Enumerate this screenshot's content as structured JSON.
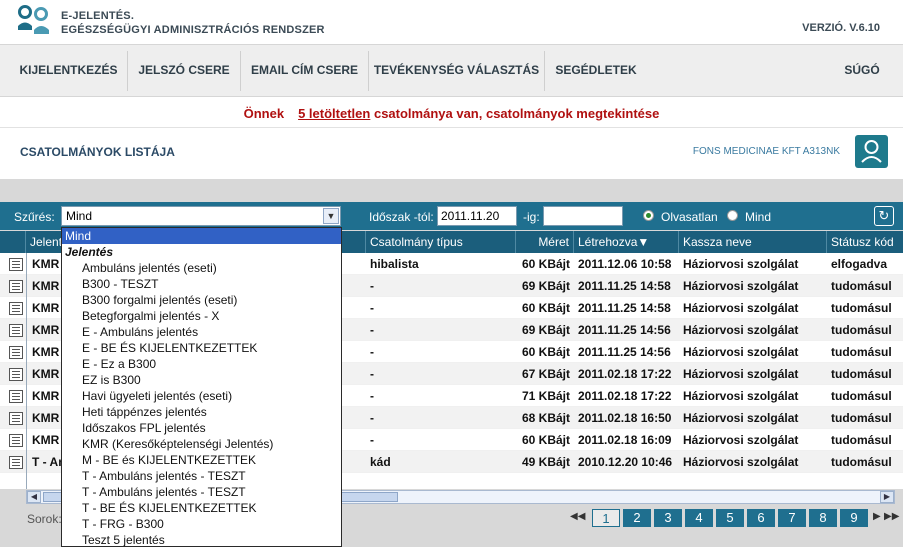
{
  "header": {
    "title_line1": "E-JELENTÉS.",
    "title_line2": "EGÉSZSÉGÜGYI ADMINISZTRÁCIÓS RENDSZER",
    "version": "VERZIÓ. V.6.10"
  },
  "nav": {
    "items": [
      "KIJELENTKEZÉS",
      "JELSZÓ CSERE",
      "EMAIL CÍM CSERE",
      "TEVÉKENYSÉG VÁLASZTÁS",
      "SEGÉDLETEK"
    ],
    "help": "SÚGÓ"
  },
  "notice": {
    "prefix": "Önnek",
    "link": "5 letöltetlen",
    "suffix": "csatolmánya van, csatolmányok megtekintése"
  },
  "page": {
    "title": "CSATOLMÁNYOK LISTÁJA",
    "company": "FONS MEDICINAE KFT A313NK"
  },
  "filter": {
    "label": "Szűrés:",
    "selected": "Mind",
    "period_from_label": "Időszak -tól:",
    "period_from_value": "2011.11.20",
    "period_to_label": "-ig:",
    "period_to_value": "",
    "radio_unread": "Olvasatlan",
    "radio_all": "Mind"
  },
  "dropdown": {
    "selected": "Mind",
    "group": "Jelentés",
    "options": [
      "Ambuláns jelentés (eseti)",
      "B300 - TESZT",
      "B300 forgalmi jelentés (eseti)",
      "Betegforgalmi jelentés - X",
      "E - Ambuláns jelentés",
      "E - BE ÉS KIJELENTKEZETTEK",
      "E - Ez a B300",
      "EZ is B300",
      "Havi ügyeleti jelentés (eseti)",
      "Heti táppénzes jelentés",
      "Időszakos FPL jelentés",
      "KMR (Keresőképtelenségi Jelentés)",
      "M - BE és KIJELENTKEZETTEK",
      "T - Ambuláns jelentés - TESZT",
      "T - Ambuláns jelentés - TESZT",
      "T - BE ÉS KIJELENTKEZETTEK",
      "T - FRG - B300",
      "Teszt 5 jelentés"
    ]
  },
  "table": {
    "headers": {
      "report": "Jelentés",
      "type": "Csatolmány típus",
      "size": "Méret",
      "created": "Létrehozva",
      "fund": "Kassza neve",
      "status": "Státusz kód"
    },
    "rows": [
      {
        "report": "KMR",
        "type": "hibalista",
        "size": "60 KBájt",
        "created": "2011.12.06 10:58",
        "fund": "Háziorvosi szolgálat",
        "status": "elfogadva"
      },
      {
        "report": "KMR",
        "type": "-",
        "size": "69 KBájt",
        "created": "2011.11.25 14:58",
        "fund": "Háziorvosi szolgálat",
        "status": "tudomásul"
      },
      {
        "report": "KMR",
        "type": "-",
        "size": "60 KBájt",
        "created": "2011.11.25 14:58",
        "fund": "Háziorvosi szolgálat",
        "status": "tudomásul"
      },
      {
        "report": "KMR",
        "type": "-",
        "size": "69 KBájt",
        "created": "2011.11.25 14:56",
        "fund": "Háziorvosi szolgálat",
        "status": "tudomásul"
      },
      {
        "report": "KMR",
        "type": "-",
        "size": "60 KBájt",
        "created": "2011.11.25 14:56",
        "fund": "Háziorvosi szolgálat",
        "status": "tudomásul"
      },
      {
        "report": "KMR",
        "type": "-",
        "size": "67 KBájt",
        "created": "2011.02.18 17:22",
        "fund": "Háziorvosi szolgálat",
        "status": "tudomásul"
      },
      {
        "report": "KMR",
        "type": "-",
        "size": "71 KBájt",
        "created": "2011.02.18 17:22",
        "fund": "Háziorvosi szolgálat",
        "status": "tudomásul"
      },
      {
        "report": "KMR",
        "type": "-",
        "size": "68 KBájt",
        "created": "2011.02.18 16:50",
        "fund": "Háziorvosi szolgálat",
        "status": "tudomásul"
      },
      {
        "report": "KMR",
        "type": "-",
        "size": "60 KBájt",
        "created": "2011.02.18 16:09",
        "fund": "Háziorvosi szolgálat",
        "status": "tudomásul"
      },
      {
        "report": "T - Am",
        "type": "kád",
        "size": "49 KBájt",
        "created": "2010.12.20 10:46",
        "fund": "Háziorvosi szolgálat",
        "status": "tudomásul"
      }
    ]
  },
  "footer": {
    "rows_label": "Sorok:",
    "pages": [
      "1",
      "2",
      "3",
      "4",
      "5",
      "6",
      "7",
      "8",
      "9"
    ],
    "current_page": "1"
  }
}
